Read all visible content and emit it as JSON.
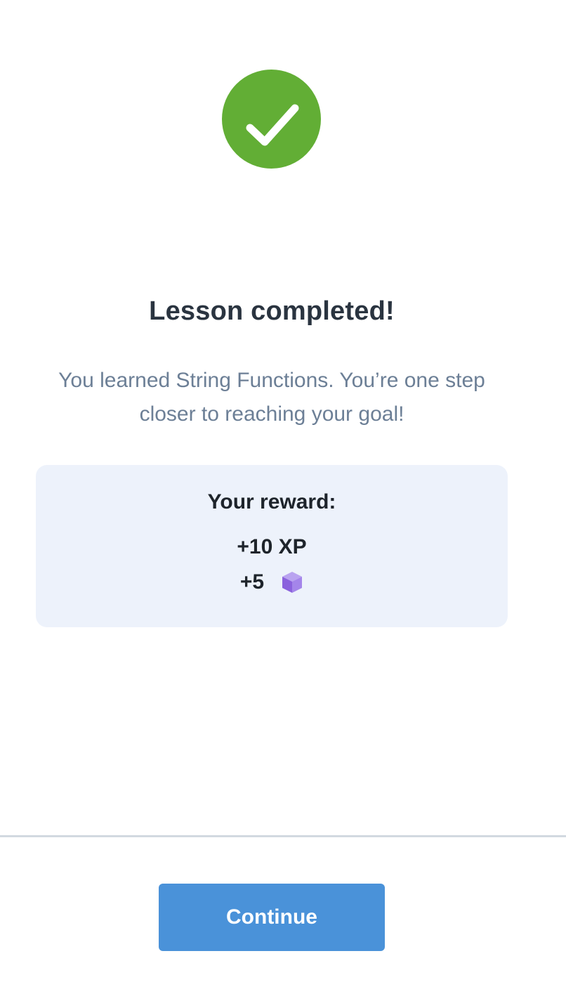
{
  "status": {
    "icon": "check-circle-icon",
    "color": "#62ae35"
  },
  "title": "Lesson completed!",
  "subtitle": "You learned String Functions. You’re one step closer to reaching your goal!",
  "reward": {
    "heading": "Your reward:",
    "xp": "+10 XP",
    "bits_amount": "+5",
    "bits_icon": "purple-cube-icon"
  },
  "actions": {
    "continue_label": "Continue",
    "continue_color": "#4a92d9"
  }
}
